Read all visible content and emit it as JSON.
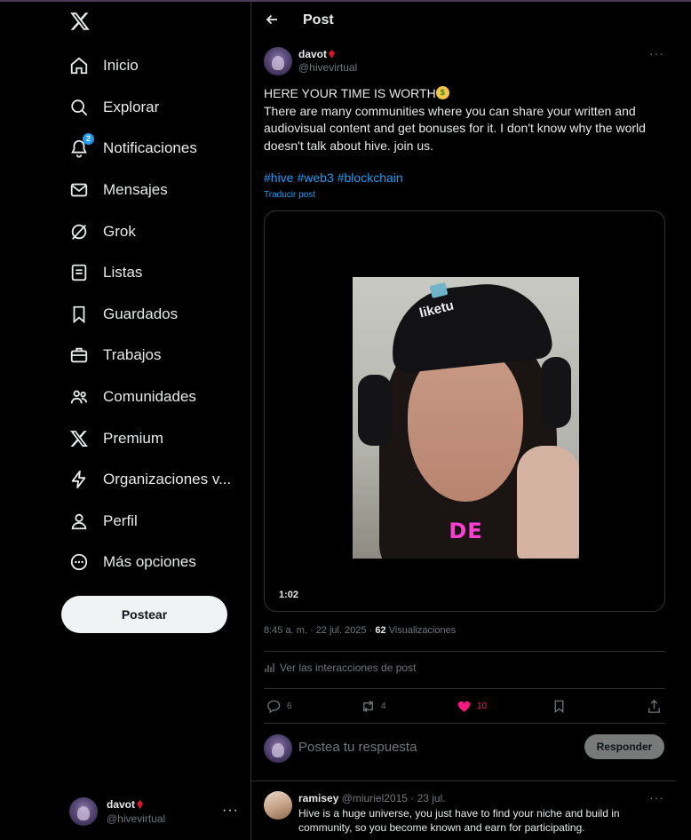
{
  "sidebar": {
    "logo": "x-logo-icon",
    "items": [
      {
        "label": "Inicio",
        "icon": "home-icon"
      },
      {
        "label": "Explorar",
        "icon": "search-icon"
      },
      {
        "label": "Notificaciones",
        "icon": "bell-icon",
        "badge": "2"
      },
      {
        "label": "Mensajes",
        "icon": "mail-icon"
      },
      {
        "label": "Grok",
        "icon": "grok-icon"
      },
      {
        "label": "Listas",
        "icon": "list-icon"
      },
      {
        "label": "Guardados",
        "icon": "bookmark-icon"
      },
      {
        "label": "Trabajos",
        "icon": "briefcase-icon"
      },
      {
        "label": "Comunidades",
        "icon": "people-icon"
      },
      {
        "label": "Premium",
        "icon": "x-logo-icon"
      },
      {
        "label": "Organizaciones v...",
        "icon": "lightning-icon"
      },
      {
        "label": "Perfil",
        "icon": "person-icon"
      },
      {
        "label": "Más opciones",
        "icon": "more-circle-icon"
      }
    ],
    "post_button": "Postear",
    "account": {
      "name": "davot",
      "handle": "@hivevirtual",
      "more": "···"
    }
  },
  "header": {
    "title": "Post"
  },
  "post": {
    "author_name": "davot",
    "author_handle": "@hivevirtual",
    "more": "···",
    "line1": "HERE YOUR TIME IS WORTH",
    "body": "There are many communities where you can share your written and audiovisual content and get bonuses for it. I don't know why the world doesn't talk about hive. join us.",
    "hashtags": [
      "#hive",
      "#web3",
      "#blockchain"
    ],
    "translate": "Traducir post",
    "video": {
      "caption": "DE",
      "cap_text": "liketu",
      "duration": "1:02"
    },
    "timestamp": "8:45 a. m. · 22 jul. 2025 · ",
    "views_count": "62",
    "views_label": " Visualizaciones",
    "interactions_link": "Ver las interacciones de post",
    "actions": {
      "replies": "6",
      "reposts": "4",
      "likes": "10"
    },
    "colors": {
      "accent": "#1d9bf0",
      "like": "#f91880",
      "caption": "#ff3fd1"
    }
  },
  "reply_box": {
    "placeholder": "Postea tu respuesta",
    "button": "Responder"
  },
  "comment": {
    "name": "ramisey",
    "handle_time": " @miuriel2015 · 23 jul.",
    "more": "···",
    "text": "Hive is a huge universe, you just have to find your niche and build in community, so you become known and earn for participating."
  }
}
